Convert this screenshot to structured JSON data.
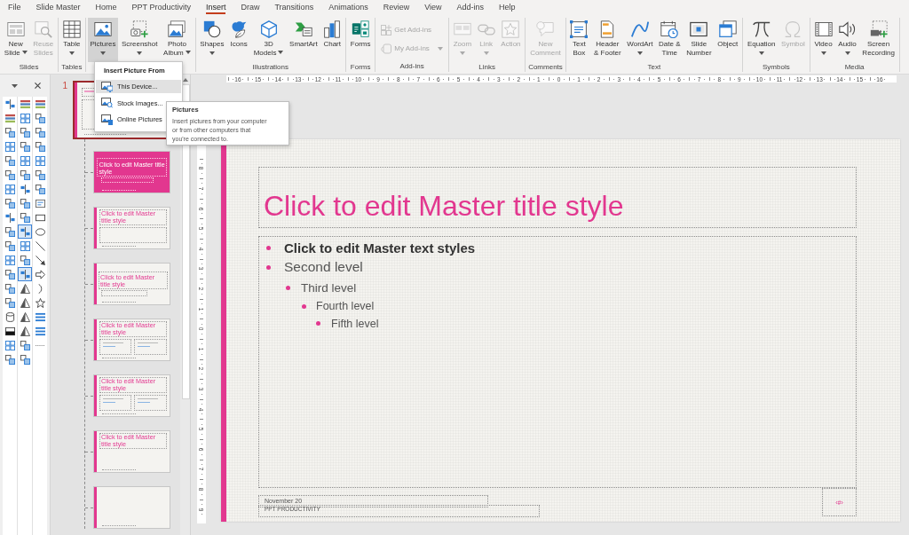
{
  "tabs": [
    {
      "label": "File",
      "selected": false
    },
    {
      "label": "Slide Master",
      "selected": false
    },
    {
      "label": "Home",
      "selected": false
    },
    {
      "label": "PPT Productivity",
      "selected": false
    },
    {
      "label": "Insert",
      "selected": true
    },
    {
      "label": "Draw",
      "selected": false
    },
    {
      "label": "Transitions",
      "selected": false
    },
    {
      "label": "Animations",
      "selected": false
    },
    {
      "label": "Review",
      "selected": false
    },
    {
      "label": "View",
      "selected": false
    },
    {
      "label": "Add-ins",
      "selected": false
    },
    {
      "label": "Help",
      "selected": false
    }
  ],
  "ribbon": {
    "groups": [
      {
        "label": "Slides",
        "buttons": [
          {
            "kind": "large",
            "label": "New\nSlide",
            "dropdown": true,
            "disabled": false,
            "expanded": false
          },
          {
            "kind": "large",
            "label": "Reuse\nSlides",
            "dropdown": false,
            "disabled": true,
            "expanded": false
          }
        ]
      },
      {
        "label": "Tables",
        "buttons": [
          {
            "kind": "large",
            "label": "Table",
            "dropdown": true,
            "disabled": false,
            "expanded": false
          }
        ]
      },
      {
        "buttons": [
          {
            "kind": "large",
            "label": "Pictures",
            "dropdown": true,
            "disabled": false,
            "expanded": true
          },
          {
            "kind": "large",
            "label": "Screenshot",
            "dropdown": true,
            "disabled": false,
            "expanded": false
          },
          {
            "kind": "large",
            "label": "Photo\nAlbum",
            "dropdown": true,
            "disabled": false,
            "expanded": false
          }
        ]
      },
      {
        "label": "Illustrations",
        "buttons": [
          {
            "kind": "large",
            "label": "Shapes",
            "dropdown": true,
            "disabled": false,
            "expanded": false
          },
          {
            "kind": "large",
            "label": "Icons",
            "dropdown": false,
            "disabled": false,
            "expanded": false
          },
          {
            "kind": "large",
            "label": "3D\nModels",
            "dropdown": true,
            "disabled": false,
            "expanded": false
          },
          {
            "kind": "large",
            "label": "SmartArt",
            "dropdown": false,
            "disabled": false,
            "expanded": false
          },
          {
            "kind": "large",
            "label": "Chart",
            "dropdown": false,
            "disabled": false,
            "expanded": false
          }
        ]
      },
      {
        "label": "Forms",
        "buttons": [
          {
            "kind": "large",
            "label": "Forms",
            "dropdown": false,
            "disabled": false,
            "expanded": false
          }
        ]
      },
      {
        "label": "Add-ins",
        "buttons": [
          {
            "kind": "small",
            "label": "Get Add-ins",
            "dropdown": false,
            "disabled": true,
            "expanded": false
          },
          {
            "kind": "small",
            "label": "My Add-ins",
            "dropdown": true,
            "disabled": true,
            "expanded": false
          }
        ]
      },
      {
        "label": "Links",
        "buttons": [
          {
            "kind": "large",
            "label": "Zoom",
            "dropdown": true,
            "disabled": true,
            "expanded": false
          },
          {
            "kind": "large",
            "label": "Link",
            "dropdown": true,
            "disabled": true,
            "expanded": false
          },
          {
            "kind": "large",
            "label": "Action",
            "dropdown": false,
            "disabled": true,
            "expanded": false
          }
        ]
      },
      {
        "label": "Comments",
        "buttons": [
          {
            "kind": "large",
            "label": "New\nComment",
            "dropdown": false,
            "disabled": true,
            "expanded": false
          }
        ]
      },
      {
        "label": "Text",
        "buttons": [
          {
            "kind": "large",
            "label": "Text\nBox",
            "dropdown": false,
            "disabled": false,
            "expanded": false
          },
          {
            "kind": "large",
            "label": "Header\n& Footer",
            "dropdown": false,
            "disabled": false,
            "expanded": false
          },
          {
            "kind": "large",
            "label": "WordArt",
            "dropdown": true,
            "disabled": false,
            "expanded": false
          },
          {
            "kind": "large",
            "label": "Date &\nTime",
            "dropdown": false,
            "disabled": false,
            "expanded": false
          },
          {
            "kind": "large",
            "label": "Slide\nNumber",
            "dropdown": false,
            "disabled": false,
            "expanded": false
          },
          {
            "kind": "large",
            "label": "Object",
            "dropdown": false,
            "disabled": false,
            "expanded": false
          }
        ]
      },
      {
        "label": "Symbols",
        "buttons": [
          {
            "kind": "large",
            "label": "Equation",
            "dropdown": true,
            "disabled": false,
            "expanded": false
          },
          {
            "kind": "large",
            "label": "Symbol",
            "dropdown": false,
            "disabled": true,
            "expanded": false
          }
        ]
      },
      {
        "label": "Media",
        "buttons": [
          {
            "kind": "large",
            "label": "Video",
            "dropdown": true,
            "disabled": false,
            "expanded": false
          },
          {
            "kind": "large",
            "label": "Audio",
            "dropdown": true,
            "disabled": false,
            "expanded": false
          },
          {
            "kind": "large",
            "label": "Screen\nRecording",
            "dropdown": false,
            "disabled": false,
            "expanded": false
          }
        ]
      }
    ]
  },
  "shape_palette": {
    "tools": [
      {
        "on": false
      },
      {
        "on": false
      },
      {
        "on": false
      },
      {
        "on": false
      },
      {
        "on": false
      },
      {
        "on": false
      },
      {
        "on": false
      },
      {
        "on": false
      },
      {
        "on": false
      },
      {
        "on": false
      },
      {
        "on": false
      },
      {
        "on": false
      },
      {
        "on": false
      },
      {
        "on": false
      },
      {
        "on": false
      },
      {
        "on": false
      },
      {
        "on": false
      },
      {
        "on": false
      },
      {
        "on": false
      },
      {
        "on": false
      },
      {
        "on": false
      },
      {
        "on": false
      },
      {
        "on": false
      },
      {
        "on": false
      },
      {
        "on": false
      },
      {
        "on": false
      },
      {
        "on": false
      },
      {
        "on": false
      },
      {
        "on": true
      },
      {
        "on": false
      },
      {
        "on": false
      },
      {
        "on": true
      },
      {
        "on": false
      },
      {
        "on": false
      },
      {
        "on": false
      },
      {
        "on": false
      },
      {
        "on": false
      },
      {
        "on": false
      },
      {
        "on": false
      },
      {
        "on": false
      },
      {
        "on": false
      },
      {
        "on": false
      },
      {
        "on": false
      },
      {
        "on": false
      },
      {
        "on": false
      },
      {
        "on": false
      },
      {
        "on": false
      },
      {
        "on": false
      },
      {
        "on": false
      },
      {
        "on": false
      },
      {
        "on": false
      },
      {
        "on": false
      },
      {
        "on": false
      },
      {
        "on": false
      },
      {
        "on": false
      },
      {
        "on": false
      }
    ]
  },
  "slide_master": {
    "number": "1",
    "selected": true,
    "children": [
      {
        "kind": "title-slide",
        "title": "Click to edit Master title style",
        "selected": false
      },
      {
        "kind": "title-content",
        "title": "Click to edit Master title style",
        "selected": false
      },
      {
        "kind": "section",
        "title": "Click to edit Master title style",
        "selected": false
      },
      {
        "kind": "two-content",
        "title": "Click to edit Master title style",
        "selected": false
      },
      {
        "kind": "comparison",
        "title": "Click to edit Master title style",
        "selected": false
      },
      {
        "kind": "title-only",
        "title": "Click to edit Master title style",
        "selected": false
      },
      {
        "kind": "blank",
        "selected": false
      }
    ]
  },
  "rulers": {
    "horizontal": [
      "16",
      "15",
      "14",
      "13",
      "12",
      "11",
      "10",
      "9",
      "8",
      "7",
      "6",
      "5",
      "4",
      "3",
      "2",
      "1",
      "0",
      "1",
      "2",
      "3",
      "4",
      "5",
      "6",
      "7",
      "8",
      "9",
      "10",
      "11",
      "12",
      "13",
      "14",
      "15",
      "16"
    ],
    "vertical": [
      "8",
      "7",
      "6",
      "5",
      "4",
      "3",
      "2",
      "1",
      "0",
      "1",
      "2",
      "3",
      "4",
      "5",
      "6",
      "7",
      "8",
      "9"
    ]
  },
  "slide": {
    "title": "Click to edit Master title style",
    "text_levels": [
      {
        "text": "Click to edit Master text styles",
        "children": [
          {
            "text": "Second level",
            "children": [
              {
                "text": "Third level",
                "children": [
                  {
                    "text": "Fourth level",
                    "children": [
                      {
                        "text": "Fifth level"
                      }
                    ]
                  }
                ]
              }
            ]
          }
        ]
      }
    ],
    "date": "November 20",
    "footer": "PPT PRODUCTIVITY",
    "slide_number": "‹#›"
  },
  "pictures_menu": {
    "heading": "Insert Picture From",
    "items": [
      {
        "label": "This Device...",
        "selected": true
      },
      {
        "label": "Stock Images...",
        "selected": false
      },
      {
        "label": "Online Pictures",
        "selected": false
      }
    ]
  },
  "tooltip": {
    "title": "Pictures",
    "text": "Insert pictures from your computer\nor from other computers that\nyou're connected to."
  }
}
